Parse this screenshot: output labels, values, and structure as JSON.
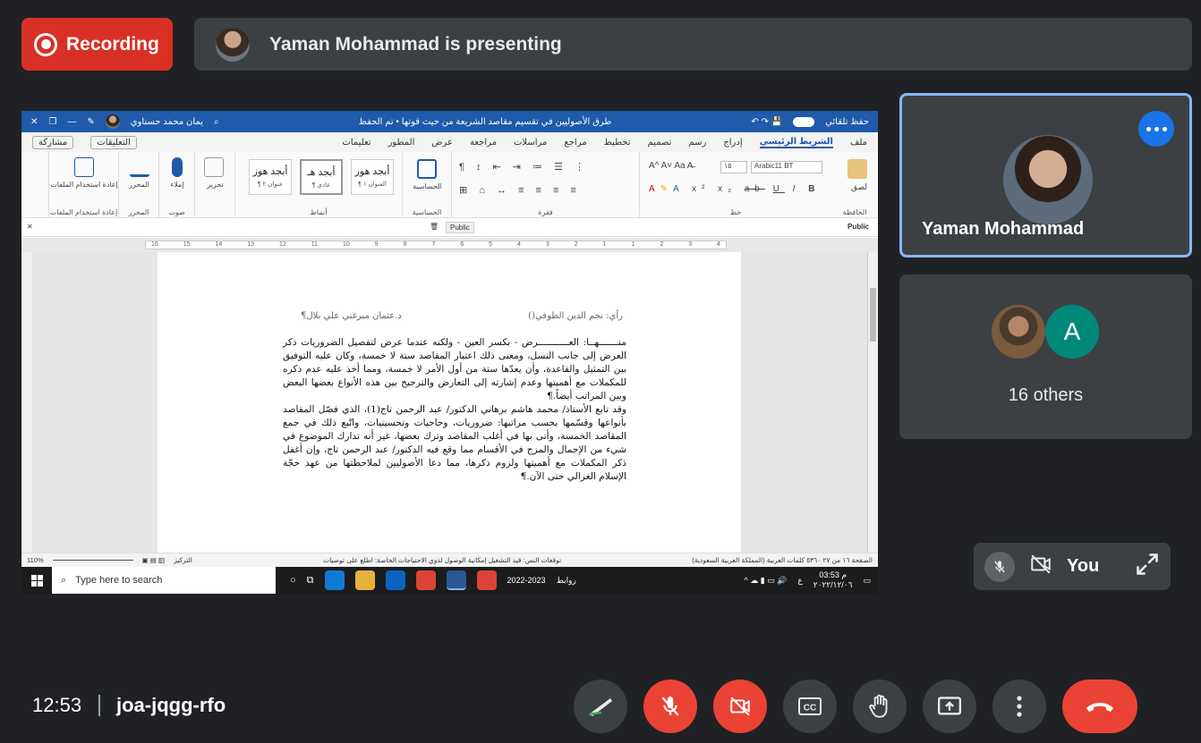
{
  "top": {
    "recording_label": "Recording",
    "presenter_text": "Yaman Mohammad is presenting"
  },
  "word": {
    "title": "طرق الأصوليين في تقسيم مقاصد الشريعة من حيث قوتها • تم الحفظ",
    "autosave": "حفظ تلقائي",
    "user": "يمان محمد حسناوي",
    "tabs": [
      "ملف",
      "الشريط الرئيسي",
      "إدراج",
      "رسم",
      "تصميم",
      "تخطيط",
      "مراجع",
      "مراسلات",
      "مراجعة",
      "عرض",
      "المطور",
      "تعليمات"
    ],
    "comments_label": "التعليقات",
    "share_label": "مشاركة",
    "font_name": "Arabic11 BT",
    "font_size": "١٥",
    "styles": [
      {
        "sample": "أبجد هوز",
        "name": "¶ العنوان ١"
      },
      {
        "sample": "أبجد هـ",
        "name": "¶ عادي"
      },
      {
        "sample": "أبجد هوز",
        "name": "¶ عنوان ٢"
      }
    ],
    "group_names": {
      "clipboard": "الحافظة",
      "font": "خط",
      "paragraph": "فقرة",
      "sensitivity": "الحساسية",
      "styles": "أنماط",
      "voice": "صوت",
      "editor": "المحرر",
      "reuse": "إعادة استخدام الملفات"
    },
    "ribbon_buttons": {
      "paste": "لصق",
      "sensitivity": "الحساسية",
      "editing": "تحرير",
      "dictate": "إملاء",
      "editor": "المحرر",
      "reuse_files": "إعادة استخدام الملفات"
    },
    "sensitivity_label": "Public",
    "ruler_marks": [
      "16",
      "15",
      "14",
      "13",
      "12",
      "11",
      "10",
      "9",
      "8",
      "7",
      "6",
      "5",
      "4",
      "3",
      "2",
      "1",
      "1",
      "2",
      "3",
      "4"
    ],
    "doc_header_right": "رأي: نجم الدين الطوفي()",
    "doc_header_left": "د.عثمان مبرغني علي بلال¶",
    "doc_paragraphs": [
      "منـــــــهــا: العـــــــــــرض - بكسر العين - ولكنه عندما عرض لتفصيل الضروريات ذكر العرض إلى جانب النسل، ومعنى ذلك اعتبار المقاصد ستة لا خمسة، وكان عليه التوفيق بين التمثيل والقاعدة، وأن يعدّها ستة من أول الأمر لا خمسة، ومما أخذ عليه عدم ذكره للمكملات مع أهميتها وعدم إشارته إلى التعارض والترجيح بين هذه الأنواع بعضها البعض وبين المراتب أيضاً.¶",
      "وقد تابع الأستاذ/ محمد هاشم برهاني الدكتور/ عبد الرحمن تاج(1)، الذي فصّل المقاصد بأنواعها وقسّمها بحسب مراتبها: ضروريات، وحاجيات وتحسينيات، واتّبع ذلك في جمع المقاصد الخمسة، وأتى بها في أغلب المقاصد وترك بعضها، غير أنه تدارك الموضوع في شيء من الإجمال والمزج في الأقسام مما وقع فيه الدكتور/ عبد الرحمن تاج، وإن أغفل ذكر المكملات مع أهميتها ولزوم ذكرها، مما دعا الأصوليين لملاحظتها من عهد حجّة الإسلام الغزالي حتى الآن.¶"
    ],
    "status_right": "الصفحة ١٦ من ٢٧   ٥٣٦٠ كلمات   العربية (المملكة العربية السعودية)",
    "status_mid": "توقعات النص: قيد التشغيل   إمكانية الوصول لذوي الاحتياجات الخاصة: اطلع على توصيات",
    "status_focus": "التركيز",
    "zoom": "110%",
    "taskbar_search": "Type here to search",
    "taskbar_folder": "2022-2023",
    "taskbar_links": "روابط",
    "clock_time": "03:53 م",
    "clock_date": "٢٠٢٢/١٢/٠٦",
    "lang": "ع"
  },
  "tiles": {
    "presenter_name": "Yaman Mohammad",
    "others_letter": "A",
    "others_label": "16 others",
    "you_label": "You"
  },
  "bottom": {
    "time": "12:53",
    "meeting_code": "joa-jqgg-rfo"
  },
  "colors": {
    "background": "#202124",
    "tile": "#3c4043",
    "recording_red": "#d93025",
    "control_red": "#ea4335",
    "active_border": "#8ab4f8",
    "avatar_teal": "#00897b",
    "word_blue": "#1f5baa"
  }
}
